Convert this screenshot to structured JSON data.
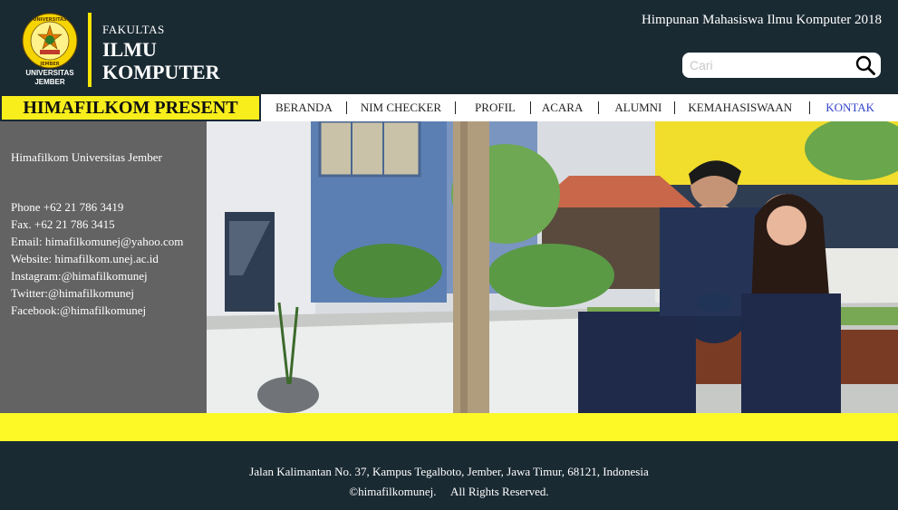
{
  "header": {
    "logo_text_top": "UNIVERSITAS",
    "logo_text_bottom": "JEMBER",
    "logo_caption_1": "UNIVERSITAS",
    "logo_caption_2": "JEMBER",
    "faculty_small": "FAKULTAS",
    "faculty_big_1": "ILMU",
    "faculty_big_2": "KOMPUTER",
    "site_title": "Himpunan Mahasiswa Ilmu Komputer 2018",
    "search_placeholder": "Cari",
    "search_icon": "search-icon"
  },
  "nav": {
    "present_label": "HIMAFILKOM PRESENT",
    "items": [
      {
        "label": "BERANDA"
      },
      {
        "label": "NIM CHECKER"
      },
      {
        "label": "PROFIL"
      },
      {
        "label": "ACARA"
      },
      {
        "label": "ALUMNI"
      },
      {
        "label": "KEMAHASISWAAN"
      },
      {
        "label": "KONTAK"
      }
    ],
    "active_color": "#3344cc"
  },
  "info": {
    "org": "Himafilkom Universitas Jember",
    "phone": "Phone +62 21 786 3419",
    "fax": "Fax. +62 21 786 3415",
    "email": "Email: himafilkomunej@yahoo.com",
    "website": "Website: himafilkom.unej.ac.id",
    "instagram": "Instagram:@himafilkomunej",
    "twitter": "Twitter:@himafilkomunej",
    "facebook": "Facebook:@himafilkomunej"
  },
  "footer": {
    "address": "Jalan Kalimantan No. 37, Kampus Tegalboto, Jember, Jawa Timur, 68121, Indonesia",
    "copyright": "©himafilkomunej.     All Rights Reserved."
  },
  "colors": {
    "dark": "#1a2a33",
    "yellow": "#f7ee1c",
    "panel_gray": "#636363"
  }
}
